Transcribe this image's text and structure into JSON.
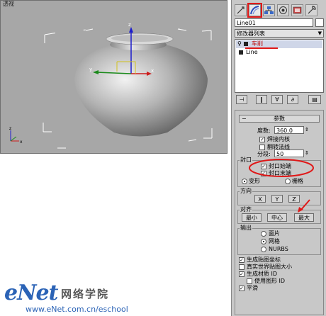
{
  "viewport": {
    "label": "透视"
  },
  "panel": {
    "tabs": [
      {
        "icon": "create-icon"
      },
      {
        "icon": "modify-icon"
      },
      {
        "icon": "hierarchy-icon"
      },
      {
        "icon": "motion-icon"
      },
      {
        "icon": "display-icon"
      },
      {
        "icon": "utilities-icon"
      }
    ],
    "object_name": "Line01",
    "modifier_list": "修改器列表",
    "stack": [
      {
        "label": "车削"
      },
      {
        "label": "Line"
      }
    ],
    "rollout_title": "参数",
    "degrees_label": "度数:",
    "degrees_value": "360.0",
    "weld_core": "焊接内核",
    "flip_normals": "翻转法线",
    "segments_label": "分段:",
    "segments_value": "50",
    "capping": {
      "title": "封口",
      "cap_start": "封口始端",
      "cap_end": "封口末端",
      "morph": "变形",
      "grid": "栅格"
    },
    "direction": {
      "title": "方向",
      "x": "X",
      "y": "Y",
      "z": "Z"
    },
    "align": {
      "title": "对齐",
      "min": "最小",
      "center": "中心",
      "max": "最大"
    },
    "output": {
      "title": "输出",
      "patch": "面片",
      "mesh": "网格",
      "nurbs": "NURBS"
    },
    "gen_mapping": "生成贴图坐标",
    "real_world": "真实世界贴图大小",
    "gen_mat_ids": "生成材质 ID",
    "use_shape_ids": "使用图形 ID",
    "smooth": "平滑"
  },
  "watermark": {
    "logo": "eNet",
    "cn": "网络学院",
    "url": "www.eNet.com.cn/eschool"
  }
}
